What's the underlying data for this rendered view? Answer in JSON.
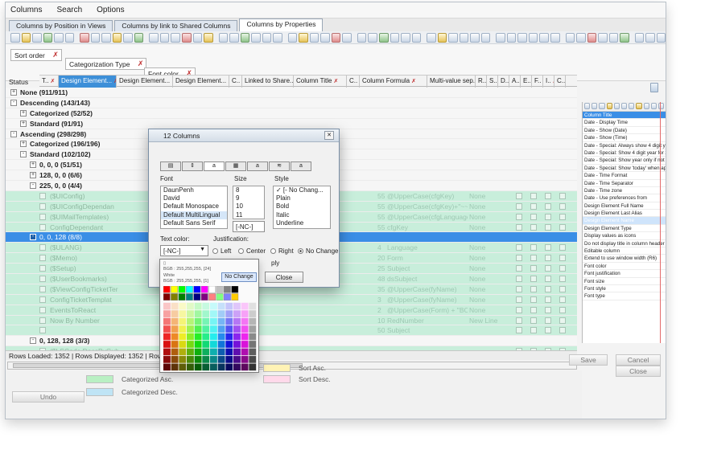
{
  "menu": [
    "Columns",
    "Search",
    "Options"
  ],
  "tabs": [
    "Columns by Position in Views",
    "Columns by link to Shared Columns",
    "Columns by Properties"
  ],
  "sort_chips": [
    "Sort order",
    "Categorization Type",
    "Font color"
  ],
  "status_label": "Status",
  "columns": [
    "T..",
    "Design Element...",
    "Design Element...",
    "Design Element...",
    "C..",
    "Linked to Share...",
    "Column Title",
    "C..",
    "Column Formula",
    "Multi-value sep...",
    "R..",
    "S..",
    "D..",
    "A..",
    "E..",
    "F..",
    "I..",
    "C.."
  ],
  "tree": [
    {
      "label": "None (911/911)",
      "level": 0,
      "sign": "+",
      "style": "group"
    },
    {
      "label": "Descending (143/143)",
      "level": 0,
      "sign": "-",
      "style": "group"
    },
    {
      "label": "Categorized (52/52)",
      "level": 1,
      "sign": "+",
      "style": "group"
    },
    {
      "label": "Standard (91/91)",
      "level": 1,
      "sign": "+",
      "style": "group"
    },
    {
      "label": "Ascending (298/298)",
      "level": 0,
      "sign": "-",
      "style": "group"
    },
    {
      "label": "Categorized (196/196)",
      "level": 1,
      "sign": "+",
      "style": "group"
    },
    {
      "label": "Standard (102/102)",
      "level": 1,
      "sign": "-",
      "style": "group"
    },
    {
      "label": "0, 0, 0 (51/51)",
      "level": 2,
      "sign": "+",
      "style": "group"
    },
    {
      "label": "128, 0, 0 (6/6)",
      "level": 2,
      "sign": "+",
      "style": "group"
    },
    {
      "label": "225, 0, 0 (4/4)",
      "level": 2,
      "sign": "-",
      "style": "group"
    },
    {
      "label": "($UIConfig)",
      "level": 3,
      "sign": "",
      "style": "green",
      "formula": "@UpperCase(cfgKey)",
      "num": "55",
      "none": "None"
    },
    {
      "label": "($UIConfigDependan",
      "level": 3,
      "sign": "",
      "style": "green",
      "formula": "@UpperCase(cfgKey)+\"~~\"+@Up",
      "num": "55",
      "none": "None"
    },
    {
      "label": "($UIMailTemplates)",
      "level": 3,
      "sign": "",
      "style": "green",
      "formula": "@UpperCase(cfgLanguage+\"~\"+cfgN",
      "num": "55",
      "none": "None"
    },
    {
      "label": "ConfigDependant",
      "level": 3,
      "sign": "",
      "style": "green",
      "formula": "cfgKey",
      "num": "55",
      "none": "None"
    },
    {
      "label": "0, 0, 128 (8/8)",
      "level": 2,
      "sign": "-",
      "style": "sel"
    },
    {
      "label": "($ULANG)",
      "level": 3,
      "sign": "",
      "style": "green",
      "formula": "Language",
      "num": "4",
      "none": "None"
    },
    {
      "label": "($Memo)",
      "level": 3,
      "sign": "",
      "style": "green",
      "formula": "Form",
      "num": "20",
      "none": "None"
    },
    {
      "label": "($Setup)",
      "level": 3,
      "sign": "",
      "style": "green",
      "formula": "Subject",
      "num": "25",
      "none": "None"
    },
    {
      "label": "($UserBookmarks)",
      "level": 3,
      "sign": "",
      "style": "green",
      "formula": "dsSubject",
      "num": "48",
      "none": "None"
    },
    {
      "label": "($ViewConfigTicketTer",
      "level": 3,
      "sign": "",
      "style": "green",
      "formula": "@UpperCase(fyName)",
      "num": "35",
      "none": "None"
    },
    {
      "label": "ConfigTicketTemplat",
      "level": 3,
      "sign": "",
      "style": "green",
      "formula": "@UpperCase(fyName)",
      "num": "3",
      "none": "None"
    },
    {
      "label": "EventsToReact",
      "level": 3,
      "sign": "",
      "style": "green",
      "formula": "@UpperCase(Form) + \"BOOKS\"",
      "num": "2",
      "none": "None"
    },
    {
      "label": "Now By Number",
      "level": 3,
      "sign": "",
      "style": "green",
      "formula": "RedNumber",
      "num": "10",
      "none": "New Line"
    },
    {
      "label": "",
      "level": 3,
      "sign": "",
      "style": "green",
      "formula": "Subject",
      "num": "50",
      "none": ""
    },
    {
      "label": "0, 128, 128 (3/3)",
      "level": 2,
      "sign": "-",
      "style": "group"
    },
    {
      "label": "($LSCode.DocsByGub",
      "level": 3,
      "sign": "",
      "style": "green",
      "formula": "",
      "num": "",
      "none": ""
    }
  ],
  "status_text": "Rows Loaded: 1352 | Rows Displayed: 1352 | Rows Selec",
  "legend": {
    "categorized_asc": "Categorized Asc.",
    "categorized_desc": "Categorized Desc.",
    "sort_asc": "Sort Asc.",
    "sort_desc": "Sort Desc.",
    "colors": {
      "asc": "#b9f0c3",
      "desc": "#bfe4f5",
      "sort_asc": "#fff3b5",
      "sort_desc": "#ffd9ea"
    }
  },
  "buttons": {
    "undo": "Undo",
    "save": "Save",
    "cancel": "Cancel",
    "close": "Close"
  },
  "right_panel": {
    "selected": "Column Title",
    "items": [
      "Date - Display Time",
      "Date - Show (Date)",
      "Date - Show (Time)",
      "Date - Special: Always show 4 digit ye",
      "Date - Special: Show 4 digit year for 2",
      "Date - Special: Show year only if not",
      "Date - Special: Show 'today' when app",
      "Date - Time Format",
      "Date - Time Separator",
      "Date - Time zone",
      "Date - Use preferences from",
      "Design Element Full Name",
      "Design Element Last Alias",
      "Design Element Name",
      "Design Element Type",
      "Display values as icons",
      "Do not display title in column header",
      "Editable column",
      "Extend to use window width (R6)",
      "Font color",
      "Font justification",
      "Font size",
      "Font style",
      "Font type"
    ],
    "highlighted": "Design Element Name"
  },
  "dialog": {
    "title": "12 Columns",
    "tab_icons": [
      "layout-icon",
      "sort-icon",
      "font-icon",
      "number-icon",
      "title-font-icon",
      "advanced-icon",
      "info-icon"
    ],
    "font_label": "Font",
    "size_label": "Size",
    "style_label": "Style",
    "fonts": [
      "DaunPenh",
      "David",
      "Default Monospace",
      "Default MultiLingual",
      "Default Sans Serif"
    ],
    "sizes": [
      "8",
      "9",
      "10",
      "11"
    ],
    "size_value": "[-NC-]",
    "styles": [
      "[- No Chang...",
      "Plain",
      "Bold",
      "Italic",
      "Underline"
    ],
    "text_color_label": "Text color:",
    "text_color_value": "[-NC-]",
    "justification_label": "Justification:",
    "justifications": [
      "Left",
      "Center",
      "Right",
      "No Change"
    ],
    "justification_selected": "No Change",
    "apply_partial": "ply",
    "close_label": "Close"
  },
  "color_popup": {
    "line1": "BGB : 255,255,255, [24]",
    "white_label": "White",
    "line2": "BGB : 255,255,255, [1]",
    "no_change": "No Change",
    "top_colors": [
      "#ff0000",
      "#ffff00",
      "#00ff00",
      "#00ffff",
      "#0000ff",
      "#ff00ff",
      "#ffffff",
      "#c0c0c0",
      "#808080",
      "#000000",
      "#800000",
      "#808000",
      "#008000",
      "#008080",
      "#000080",
      "#800080",
      "#ff8080",
      "#80ff80",
      "#8080ff",
      "#ffcc00"
    ]
  }
}
